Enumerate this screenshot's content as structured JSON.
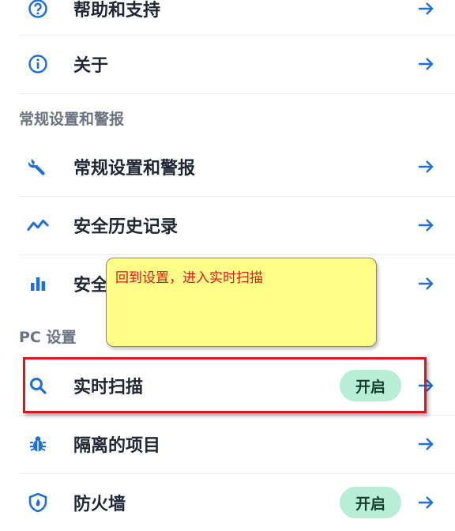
{
  "items": {
    "help": {
      "label": "帮助和支持",
      "icon": "question-circle-icon"
    },
    "about": {
      "label": "关于",
      "icon": "info-circle-icon"
    },
    "general_alerts": {
      "label": "常规设置和警报",
      "icon": "wrench-icon"
    },
    "security_history": {
      "label": "安全历史记录",
      "icon": "trend-line-icon"
    },
    "security_report": {
      "label": "安全",
      "icon": "bar-chart-icon"
    },
    "realtime_scan": {
      "label": "实时扫描",
      "icon": "search-icon",
      "status": "开启"
    },
    "quarantine": {
      "label": "隔离的项目",
      "icon": "bug-icon"
    },
    "firewall": {
      "label": "防火墙",
      "icon": "shield-icon",
      "status": "开启"
    }
  },
  "sections": {
    "general": "常规设置和警报",
    "pc": "PC 设置"
  },
  "annotation": {
    "note": "回到设置，进入实时扫描"
  },
  "colors": {
    "accent": "#1f6fd6",
    "badge_bg": "#b9eed6",
    "highlight": "#d61a1a",
    "note_bg": "#ffff88"
  }
}
